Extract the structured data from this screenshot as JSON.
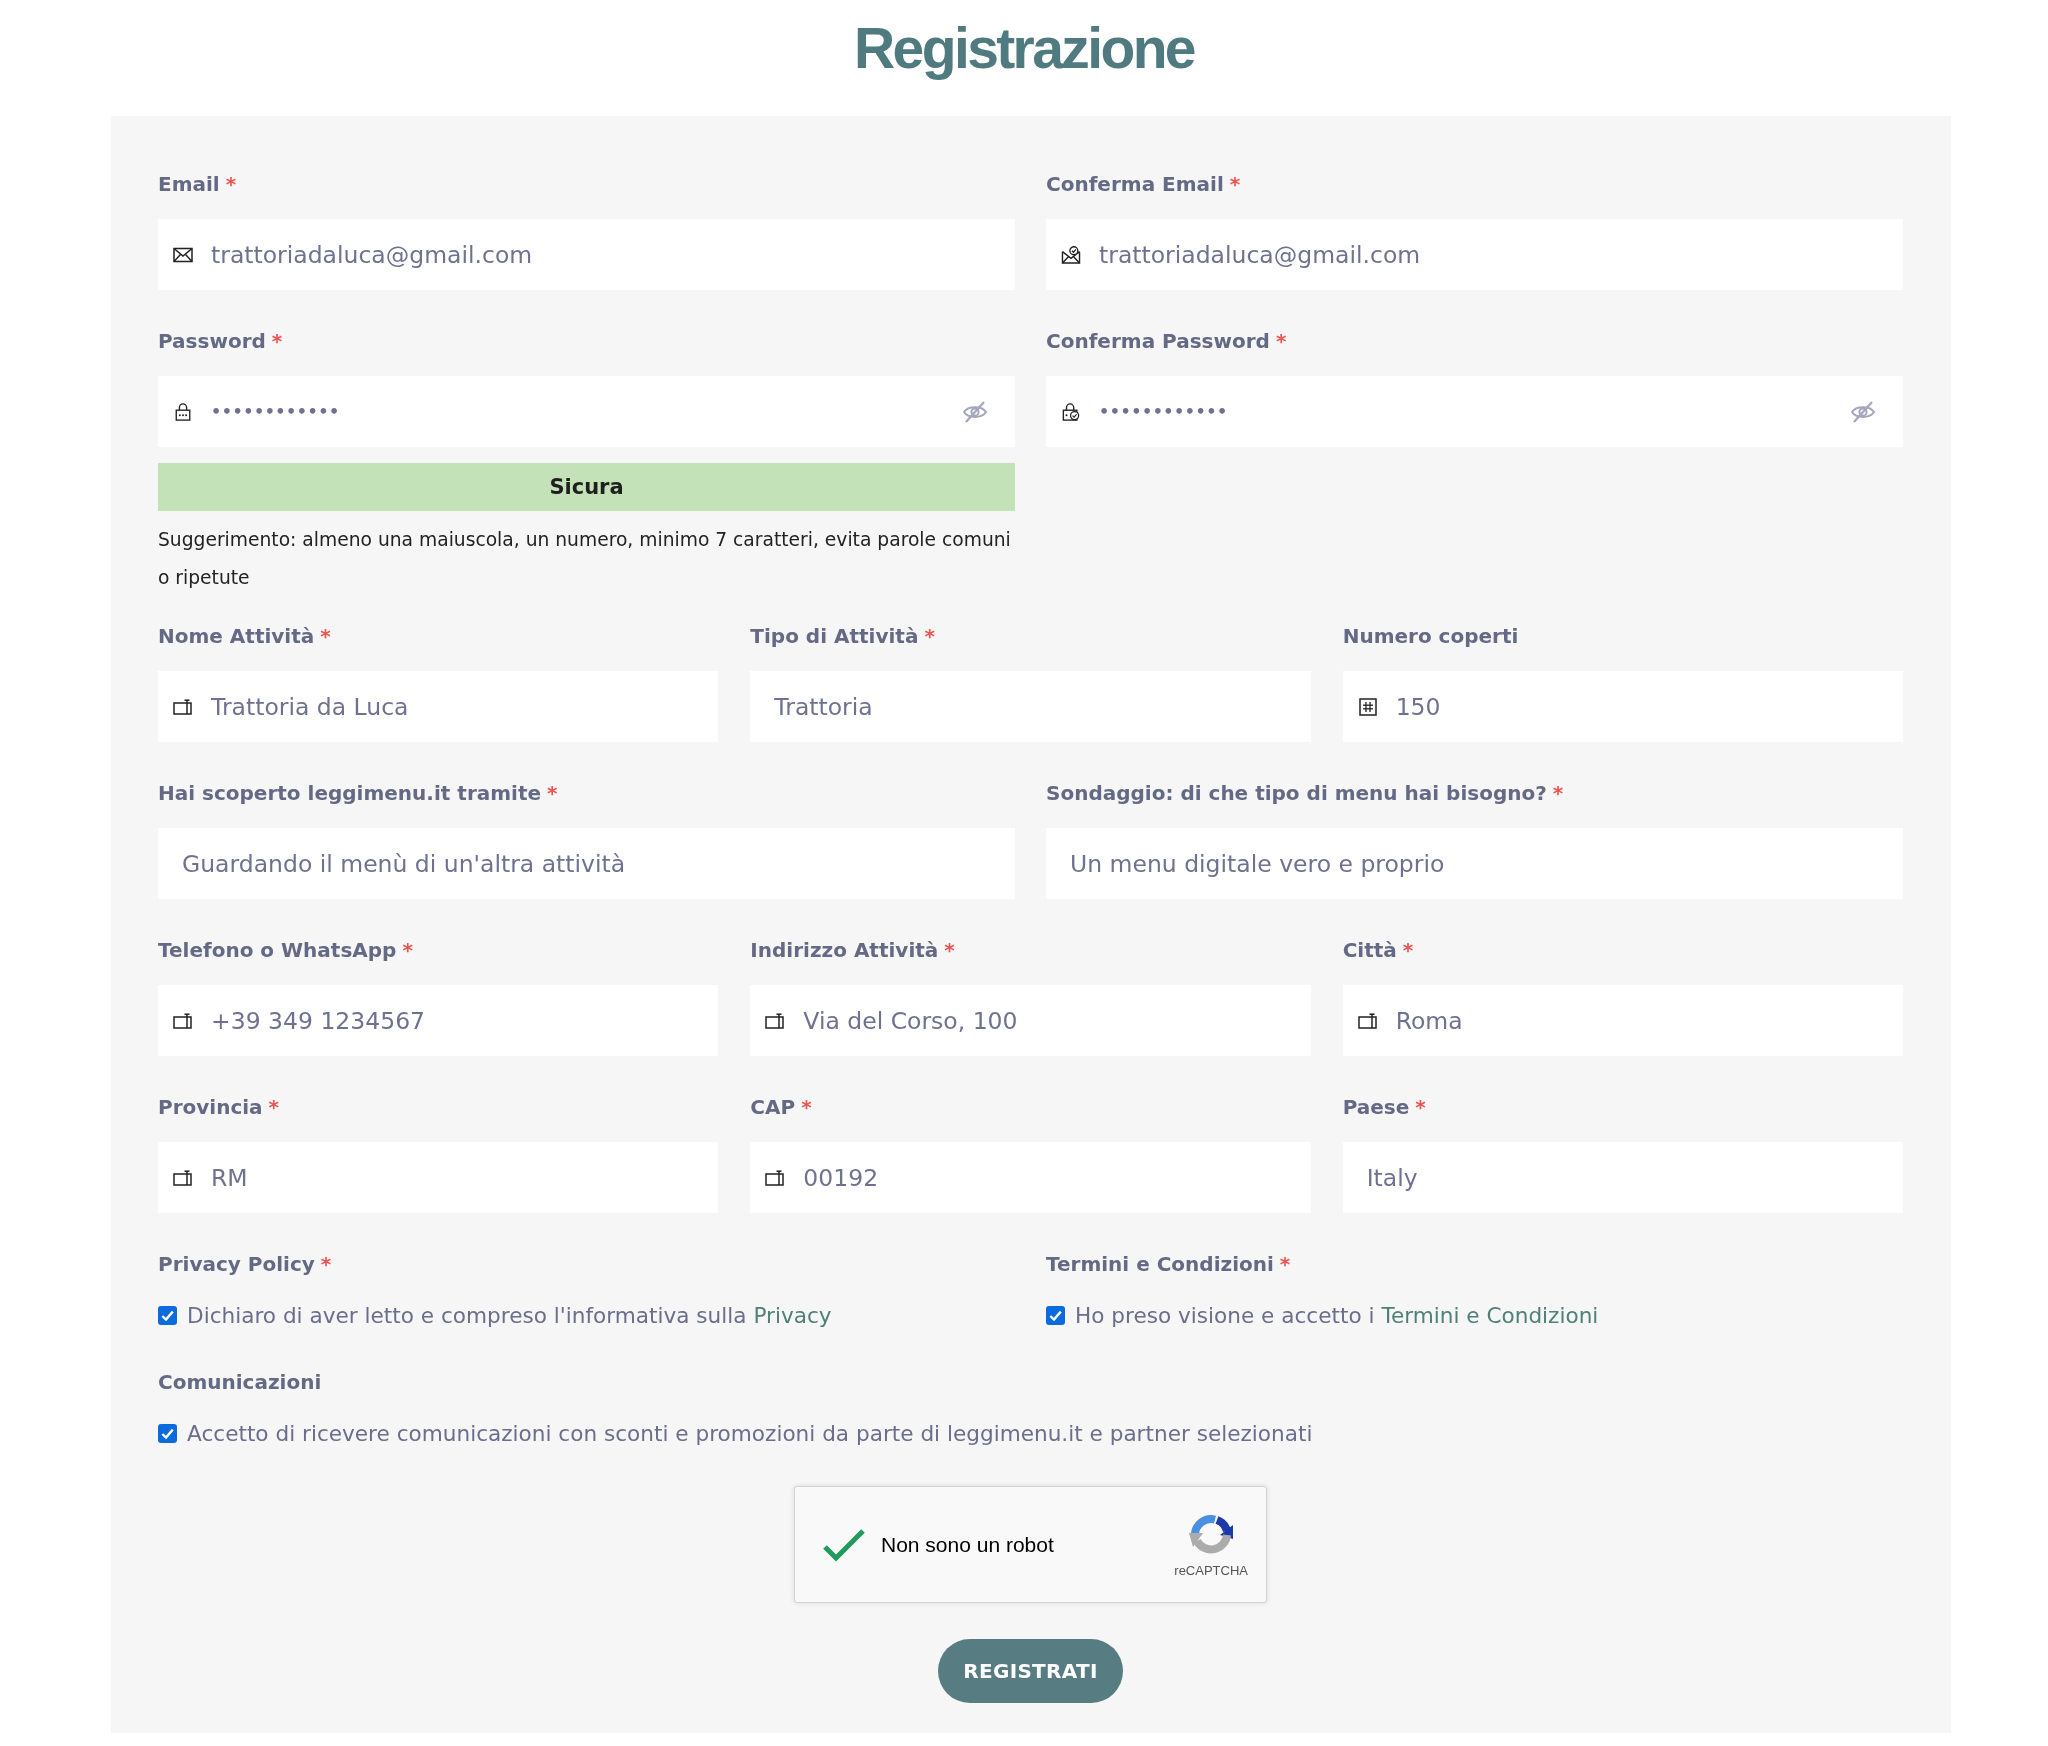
{
  "title": "Registrazione",
  "rows": [
    {
      "fields": [
        {
          "kind": "email",
          "label": "Email",
          "mark": "*",
          "value": "trattoriadaluca@gmail.com"
        },
        {
          "kind": "emailconfirm",
          "label": "Conferma Email",
          "mark": "*",
          "value": "trattoriadaluca@gmail.com"
        }
      ]
    },
    {
      "fields": [
        {
          "kind": "password",
          "label": "Password",
          "mark": "*",
          "value": "••••••••••••",
          "revealed": false,
          "strength": "Sicura",
          "hint": "Suggerimento: almeno una maiuscola, un numero, minimo 7 caratteri, evita parole comuni o ripetute"
        },
        {
          "kind": "passwordconfirm",
          "label": "Conferma Password",
          "mark": "*",
          "value": "••••••••••••",
          "revealed": false
        }
      ]
    },
    {
      "fields": [
        {
          "kind": "text",
          "label": "Nome Attività",
          "mark": "*",
          "value": "Trattoria da Luca"
        },
        {
          "kind": "select",
          "label": "Tipo di Attività",
          "mark": "*",
          "value": "Trattoria"
        },
        {
          "kind": "number",
          "label": "Numero coperti",
          "value": "150"
        }
      ]
    },
    {
      "fields": [
        {
          "kind": "select",
          "label": "Hai scoperto leggimenu.it tramite",
          "mark": "*",
          "value": "Guardando il menù di un'altra attività"
        },
        {
          "kind": "select",
          "label": "Sondaggio: di che tipo di menu hai bisogno?",
          "mark": "*",
          "value": "Un menu digitale vero e proprio"
        }
      ]
    },
    {
      "fields": [
        {
          "kind": "text",
          "label": "Telefono o WhatsApp",
          "mark": "*",
          "value": "+39 349 1234567"
        },
        {
          "kind": "text",
          "label": "Indirizzo Attività",
          "mark": "*",
          "value": "Via del Corso, 100"
        },
        {
          "kind": "text",
          "label": "Città",
          "mark": "*",
          "value": "Roma"
        }
      ]
    },
    {
      "fields": [
        {
          "kind": "text",
          "label": "Provincia",
          "mark": "*",
          "value": "RM"
        },
        {
          "kind": "text",
          "label": "CAP",
          "mark": "*",
          "value": "00192"
        },
        {
          "kind": "select",
          "label": "Paese",
          "mark": "*",
          "value": "Italy"
        }
      ]
    }
  ],
  "consent_rows": [
    {
      "items": [
        {
          "label": "Privacy Policy",
          "mark": "*",
          "text": "Dichiaro di aver letto e compreso l'informativa sulla",
          "link": "Privacy",
          "checked": true
        },
        {
          "label": "Termini e Condizioni",
          "mark": "*",
          "text": "Ho preso visione e accetto i",
          "link": "Termini e Condizioni",
          "checked": true
        }
      ]
    },
    {
      "items": [
        {
          "label": "Comunicazioni",
          "text": "Accetto di ricevere comunicazioni con sconti e promozioni da parte di leggimenu.it e partner selezionati",
          "checked": true
        }
      ]
    }
  ],
  "captcha": {
    "label": "Non sono un robot",
    "brand": "reCAPTCHA",
    "checked": true
  },
  "submit": "REGISTRATI"
}
